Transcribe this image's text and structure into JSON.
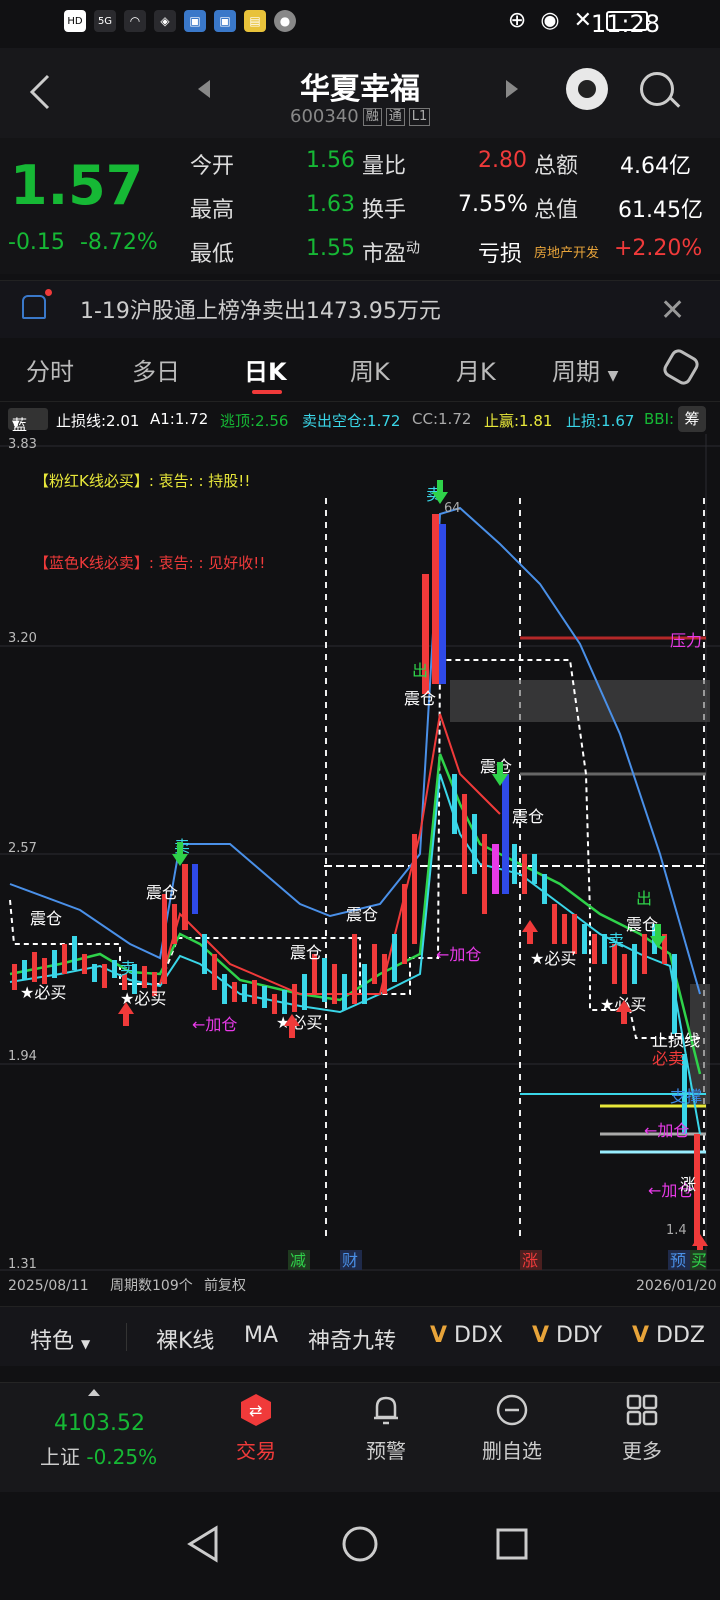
{
  "status_bar": {
    "time": "11:28",
    "hd": "HD",
    "signal": "5G"
  },
  "header": {
    "title": "华夏幸福",
    "code": "600340",
    "tags": [
      "融",
      "通",
      "L1"
    ]
  },
  "quote": {
    "price": "1.57",
    "change": "-0.15",
    "change_pct": "-8.72%",
    "cells": [
      {
        "label": "今开",
        "value": "1.56"
      },
      {
        "label": "最高",
        "value": "1.63"
      },
      {
        "label": "最低",
        "value": "1.55"
      },
      {
        "label": "量比",
        "value": "2.80"
      },
      {
        "label": "换手",
        "value": "7.55%"
      },
      {
        "label": "市盈",
        "value": "亏损",
        "sup": "动"
      },
      {
        "label": "总额",
        "value": "4.64亿"
      },
      {
        "label": "总值",
        "value": "61.45亿"
      },
      {
        "label": "房地产开发",
        "value": "+2.20%"
      }
    ]
  },
  "notice": {
    "text": "1-19沪股通上榜净卖出1473.95万元"
  },
  "tabs": [
    "分时",
    "多日",
    "日K",
    "周K",
    "月K",
    "周期"
  ],
  "indicator_bar": {
    "selector": "蓝",
    "items": [
      "止损线:2.01",
      "A1:1.72",
      "逃顶:2.56",
      "卖出空仓:1.72",
      "CC:1.72",
      "止赢:1.81",
      "止损:1.67",
      "BBI:"
    ],
    "button": "筹"
  },
  "chart": {
    "y_labels": [
      "3.83",
      "3.20",
      "2.57",
      "1.94",
      "1.31"
    ],
    "date_start": "2025/08/11",
    "period_count": "周期数109个",
    "adjust": "前复权",
    "date_end": "2026/01/20",
    "notes": [
      "【粉红K线必买】: 衷告: : 持股!!",
      "【蓝色K线必卖】: 衷告: : 见好收!!"
    ],
    "markers": [
      "减",
      "财",
      "涨",
      "预",
      "买"
    ],
    "labels": {
      "pressure": "压力",
      "support": "支撑",
      "stoploss": "止损线",
      "mustsell": "必卖",
      "add": "←加仓",
      "shake": "震仓",
      "sell": "卖",
      "buy": "★必买",
      "out": "出",
      "rise": "涨",
      "val": "64",
      "k": "1.4"
    }
  },
  "features": [
    "特色",
    "裸K线",
    "MA",
    "神奇九转",
    "DDX",
    "DDY",
    "DDZ"
  ],
  "bottom": {
    "index_value": "4103.52",
    "index_name": "上证",
    "index_change": "-0.25%",
    "nav": [
      "交易",
      "预警",
      "删自选",
      "更多"
    ]
  },
  "colors": {
    "up": "#f03a3a",
    "down": "#16b835",
    "accent": "#f03a3a"
  }
}
